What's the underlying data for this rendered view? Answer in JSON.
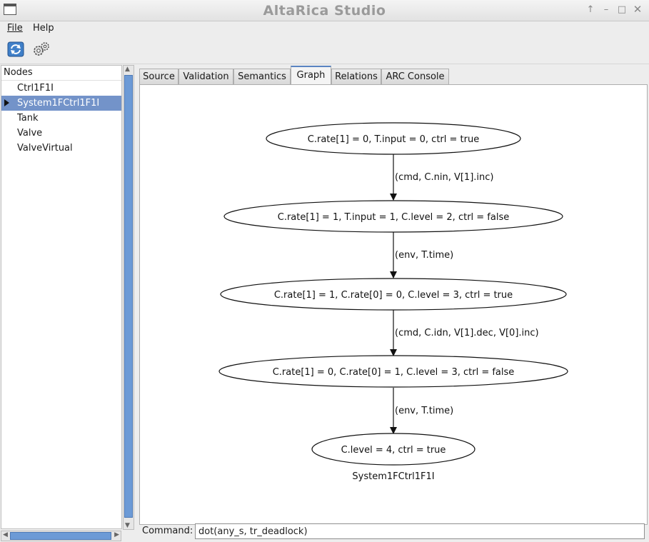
{
  "window": {
    "title": "AltaRica Studio"
  },
  "menubar": {
    "items": [
      {
        "label": "File"
      },
      {
        "label": "Help"
      }
    ]
  },
  "toolbar": {
    "icons": [
      "refresh-icon",
      "settings-gears-icon"
    ]
  },
  "sidebar": {
    "header": "Nodes",
    "items": [
      {
        "label": "Ctrl1F1I",
        "selected": false
      },
      {
        "label": "System1FCtrl1F1I",
        "selected": true,
        "expandable": true
      },
      {
        "label": "Tank",
        "selected": false
      },
      {
        "label": "Valve",
        "selected": false
      },
      {
        "label": "ValveVirtual",
        "selected": false
      }
    ]
  },
  "tabs": [
    {
      "label": "Source"
    },
    {
      "label": "Validation"
    },
    {
      "label": "Semantics"
    },
    {
      "label": "Graph",
      "active": true
    },
    {
      "label": "Relations"
    },
    {
      "label": "ARC Console"
    }
  ],
  "graph": {
    "states": [
      "C.rate[1] = 0, T.input = 0, ctrl = true",
      "C.rate[1] = 1, T.input = 1, C.level = 2, ctrl = false",
      "C.rate[1] = 1, C.rate[0] = 0, C.level = 3, ctrl = true",
      "C.rate[1] = 0, C.rate[0] = 1, C.level = 3, ctrl = false",
      "C.level = 4, ctrl = true"
    ],
    "transitions": [
      "(cmd, C.nin, V[1].inc)",
      "(env, T.time)",
      "(cmd, C.idn, V[1].dec, V[0].inc)",
      "(env, T.time)"
    ],
    "caption": "System1FCtrl1F1I"
  },
  "command": {
    "label": "Command:",
    "value": "dot(any_s, tr_deadlock)"
  },
  "colors": {
    "selection": "#7393c9",
    "scroll_thumb": "#6c9ad6",
    "active_tab_accent": "#5a84c2"
  }
}
